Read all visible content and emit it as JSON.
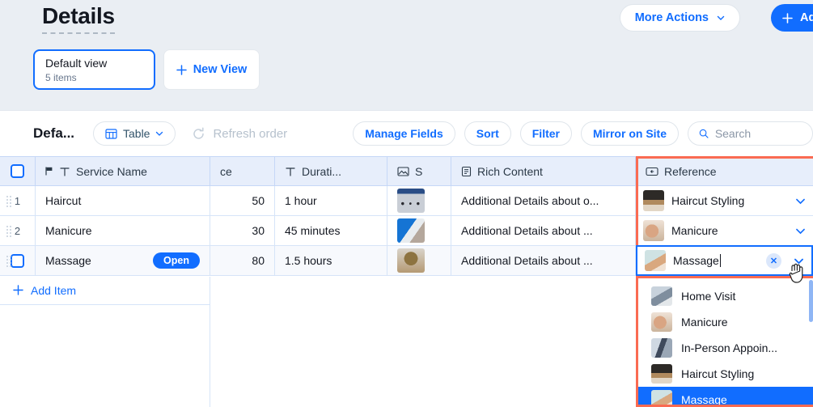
{
  "header": {
    "title": "Details",
    "more_actions_label": "More Actions",
    "add_label": "Add"
  },
  "views": {
    "default_view_title": "Default view",
    "default_view_subtitle": "5 items",
    "new_view_label": "New View"
  },
  "toolbar": {
    "view_name": "Defa...",
    "table_label": "Table",
    "refresh_label": "Refresh order",
    "manage_fields_label": "Manage Fields",
    "sort_label": "Sort",
    "filter_label": "Filter",
    "mirror_label": "Mirror on Site",
    "search_placeholder": "Search",
    "search_value": ""
  },
  "grid": {
    "columns": [
      {
        "key": "handle",
        "label": "",
        "icon": "checkbox-icon"
      },
      {
        "key": "name",
        "label": "Service Name",
        "icon": "text-type-icon"
      },
      {
        "key": "price",
        "label": "ce",
        "icon": ""
      },
      {
        "key": "duration",
        "label": "Durati...",
        "icon": "text-type-icon"
      },
      {
        "key": "image",
        "label": "S",
        "icon": "image-type-icon"
      },
      {
        "key": "rich",
        "label": "Rich Content",
        "icon": "document-type-icon"
      },
      {
        "key": "reference",
        "label": "Reference",
        "icon": "link-type-icon"
      }
    ],
    "rows": [
      {
        "num": "1",
        "name": "Haircut",
        "badge": "",
        "price": "50",
        "duration": "1 hour",
        "rich": "Additional Details about o...",
        "reference": "Haircut Styling",
        "selected": false
      },
      {
        "num": "2",
        "name": "Manicure",
        "badge": "",
        "price": "30",
        "duration": "45 minutes",
        "rich": "Additional Details about ...",
        "reference": "Manicure",
        "selected": false
      },
      {
        "num": "",
        "name": "Massage",
        "badge": "Open",
        "price": "80",
        "duration": "1.5 hours",
        "rich": "Additional Details about ...",
        "reference": "Massage",
        "selected": true
      }
    ],
    "add_item_label": "Add Item"
  },
  "dropdown": {
    "editing_value": "Massage",
    "items": [
      {
        "label": "Home Visit",
        "active": false
      },
      {
        "label": "Manicure",
        "active": false
      },
      {
        "label": "In-Person Appoin...",
        "active": false
      },
      {
        "label": "Haircut Styling",
        "active": false
      },
      {
        "label": "Massage",
        "active": true
      }
    ]
  },
  "colors": {
    "accent": "#116dff",
    "highlight_border": "#fa6b52",
    "page_bg": "#eaeef3",
    "header_bg": "#e7eefb"
  }
}
